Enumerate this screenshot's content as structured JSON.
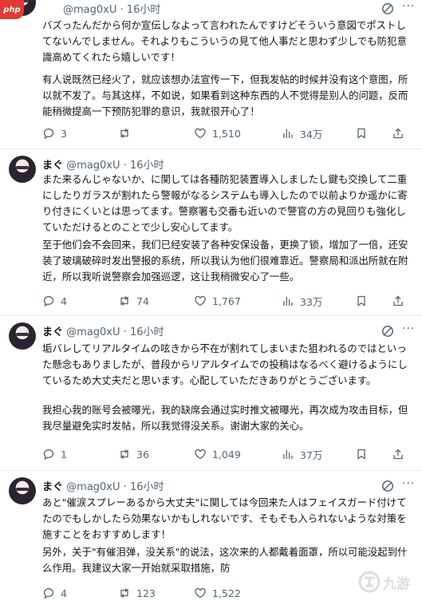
{
  "watermark_top_left": "php",
  "watermark_bottom_right": "九游",
  "tweets": [
    {
      "name": "",
      "handle": "@mag0xU",
      "time": "16小时",
      "jp": "バズったんだから何か宣伝しなよって言われたんですけどそういう意図でポストしてないんでしません。それよりもこういうの見て他人事だと思わず少しでも防犯意識高めてくれたら嬉しいです！",
      "cn": "有人说既然已经火了，就应该想办法宣传一下，但我发帖的时候并没有这个意图，所以就不发了。与其这样，不如说，如果看到这种东西的人不觉得是别人的问题，反而能稍微提高一下预防犯罪的意识，我就很开心了！",
      "replies": "3",
      "retweets": "",
      "likes": "1,510",
      "views": "34万"
    },
    {
      "name": "まぐ",
      "handle": "@mag0xU",
      "time": "16小时",
      "jp": "また来るんじゃないか、に関しては各種防犯装置導入しましたし鍵も交換して二重にしたりガラスが割れたら警報がなるシステムも導入したので以前よりか遥かに寄り付きにくいとは思ってます。警察署も交番も近いので警官の方の見回りも強化していただけるとのことで少し安心してます。",
      "cn": "至于他们会不会回来，我们已经安装了各种安保设备，更换了锁，增加了一倍，还安装了玻璃破碎时发出警报的系统，所以我认为他们很难靠近。警察局和派出所就在附近，所以我听说警察会加强巡逻，这让我稍微安心了一些。",
      "replies": "4",
      "retweets": "74",
      "likes": "1,767",
      "views": "33万"
    },
    {
      "name": "まぐ",
      "handle": "@mag0xU",
      "time": "16小时",
      "jp": "垢バレしてリアルタイムの呟きから不在が割れてしまいまた狙われるのではといった懸念もありましたが、普段からリアルタイムでの投稿はなるべく避けるようにしているため大丈夫だと思います。心配していただきありがとうございます。",
      "cn": "我担心我的账号会被曝光，我的缺席会通过实时推文被曝光，再次成为攻击目标，但我尽量避免实时发帖，所以我觉得没关系。谢谢大家的关心。",
      "replies": "1",
      "retweets": "36",
      "likes": "1,049",
      "views": "37万"
    },
    {
      "name": "まぐ",
      "handle": "@mag0xU",
      "time": "16小时",
      "jp": "あと\"催涙スプレーあるから大丈夫\"に関しては今回来た人はフェイスガード付けてたのでもしかしたら効果ないかもしれないです、そもそも入られないような対策を施すことをおすすめします！",
      "cn": "另外，关于\"有催泪弹，没关系\"的说法，这次来的人都戴着面罩，所以可能没起到什么作用。我建议大家一开始就采取措施，防",
      "replies": "4",
      "retweets": "123",
      "likes": "1,522",
      "views": ""
    }
  ]
}
